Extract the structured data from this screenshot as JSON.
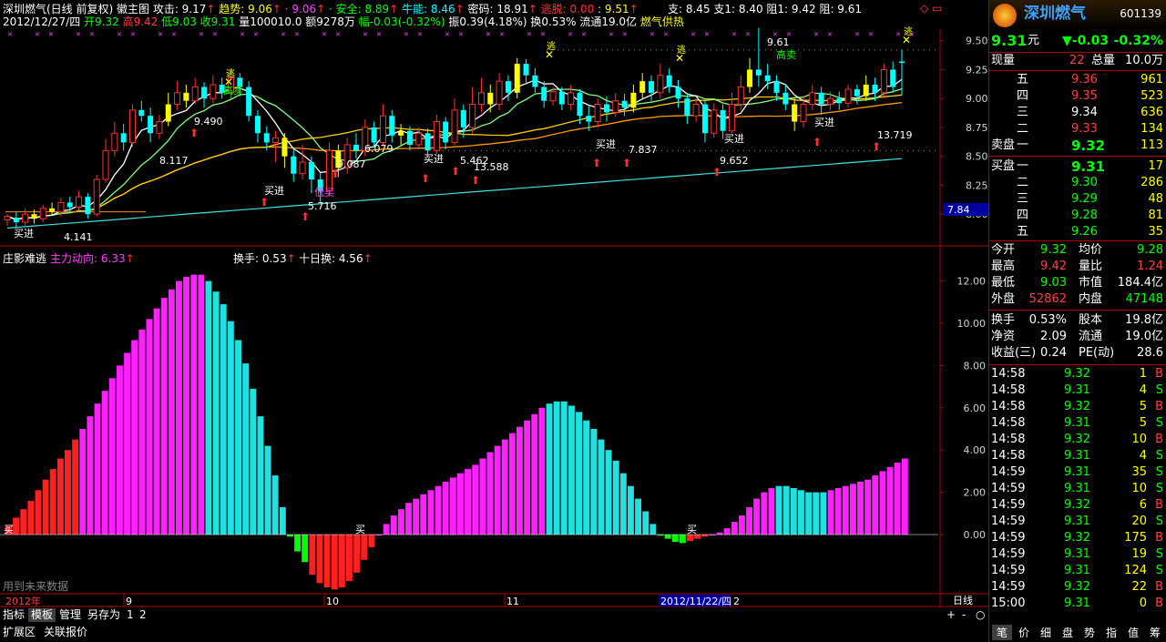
{
  "header": {
    "line1": [
      {
        "t": "深圳燃气(日线 前复权) 徽主图 ",
        "c": "#fff"
      },
      {
        "t": "攻击: 9.17",
        "c": "#fff"
      },
      {
        "t": "↑",
        "c": "#ff3030"
      },
      {
        "t": "  趋势: 9.06",
        "c": "#ffff00"
      },
      {
        "t": "↑",
        "c": "#ff3030"
      },
      {
        "t": "  ·  9.06",
        "c": "#ff40ff"
      },
      {
        "t": "↑",
        "c": "#ff3030"
      },
      {
        "t": "  · 安全: 8.89",
        "c": "#00ff00"
      },
      {
        "t": "↑",
        "c": "#ff3030"
      },
      {
        "t": "  牛能: 8.46",
        "c": "#00ffff"
      },
      {
        "t": "↑",
        "c": "#ff3030"
      },
      {
        "t": "  密码: 18.91",
        "c": "#fff"
      },
      {
        "t": "↑",
        "c": "#ff3030"
      },
      {
        "t": "  逃脱: 0.00",
        "c": "#ff3030"
      },
      {
        "t": "  : 9.51",
        "c": "#ffff00"
      },
      {
        "t": "↑",
        "c": "#ff3030"
      }
    ],
    "line2": [
      {
        "t": "2012/12/27/四 ",
        "c": "#fff"
      },
      {
        "t": "开9.32 ",
        "c": "#00ff00"
      },
      {
        "t": "高9.42 ",
        "c": "#ff4040"
      },
      {
        "t": "低9.03 ",
        "c": "#00ff00"
      },
      {
        "t": "收9.31 ",
        "c": "#00ff00"
      },
      {
        "t": "量100010.0 ",
        "c": "#fff"
      },
      {
        "t": "额9278万 ",
        "c": "#fff"
      },
      {
        "t": "幅-0.03(-0.32%) ",
        "c": "#00ff00"
      },
      {
        "t": "振0.39(4.18%) ",
        "c": "#fff"
      },
      {
        "t": "换0.53% ",
        "c": "#fff"
      },
      {
        "t": "流通19.0亿 ",
        "c": "#fff"
      },
      {
        "t": "燃气供热",
        "c": "#ffff00"
      }
    ],
    "support": "支: 8.45  支1: 8.40  阻1: 9.42  阻: 9.61"
  },
  "price_axis": [
    "9.50",
    "9.25",
    "9.00",
    "8.75",
    "8.50",
    "8.25",
    "8.00",
    "7.84"
  ],
  "indicator_axis": [
    "12.00",
    "10.00",
    "8.00",
    "6.00",
    "4.00",
    "2.00",
    "0.00"
  ],
  "indicator_header": {
    "name": "庄影难逃",
    "main_label": "主力动向: 6.33",
    "turnover": "换手: 0.53",
    "ten_day": "十日换: 4.56"
  },
  "annotations": {
    "p1": "8.117",
    "p2": "9.490",
    "p3": "5.716",
    "p4": "6.079",
    "p5": "9.087",
    "p6": "5.462",
    "p7": "13.588",
    "p8": "7.837",
    "p9": "9.652",
    "p10": "9.61",
    "p11": "13.719",
    "p12": "4.141",
    "buy": "买进",
    "sell_high": "高卖",
    "escape": "逃",
    "low_buy": "低买",
    "buy_short": "买"
  },
  "footer_note": "用到未来数据",
  "time_axis": {
    "start": "2012年",
    "m9": "9",
    "m10": "10",
    "m11": "11",
    "cursor": "2012/11/22/四",
    "m12": "2",
    "period": "日线"
  },
  "tabs": [
    "指标",
    "模板",
    "管理",
    "另存为",
    "1",
    "2"
  ],
  "bottom_tabs": [
    "扩展区",
    "关联报价"
  ],
  "zoom": [
    "+",
    "-",
    "○"
  ],
  "quote": {
    "name": "深圳燃气",
    "code": "601139",
    "price": "9.31",
    "unit": "元",
    "change": "▼-0.03",
    "pct": "-0.32%",
    "now_label": "现量",
    "now_val": "22",
    "total_label": "总量",
    "total_val": "10.0万",
    "asks": [
      {
        "l": "五",
        "p": "9.36",
        "v": "961"
      },
      {
        "l": "四",
        "p": "9.35",
        "v": "523"
      },
      {
        "l": "三",
        "p": "9.34",
        "v": "636"
      },
      {
        "l": "二",
        "p": "9.33",
        "v": "134"
      },
      {
        "l": "一",
        "p": "9.32",
        "v": "113"
      }
    ],
    "ask_label": "卖盘",
    "bid_label": "买盘",
    "bids": [
      {
        "l": "一",
        "p": "9.31",
        "v": "17"
      },
      {
        "l": "二",
        "p": "9.30",
        "v": "286"
      },
      {
        "l": "三",
        "p": "9.29",
        "v": "48"
      },
      {
        "l": "四",
        "p": "9.28",
        "v": "81"
      },
      {
        "l": "五",
        "p": "9.26",
        "v": "35"
      }
    ],
    "stats": [
      {
        "l1": "今开",
        "v1": "9.32",
        "c1": "green",
        "l2": "均价",
        "v2": "9.28",
        "c2": "green"
      },
      {
        "l1": "最高",
        "v1": "9.42",
        "c1": "red",
        "l2": "量比",
        "v2": "1.24",
        "c2": "red"
      },
      {
        "l1": "最低",
        "v1": "9.03",
        "c1": "green",
        "l2": "市值",
        "v2": "184.4亿",
        "c2": "white"
      },
      {
        "l1": "外盘",
        "v1": "52862",
        "c1": "red",
        "l2": "内盘",
        "v2": "47148",
        "c2": "green"
      }
    ],
    "stats2": [
      {
        "l1": "换手",
        "v1": "0.53%",
        "l2": "股本",
        "v2": "19.8亿"
      },
      {
        "l1": "净资",
        "v1": "2.09",
        "l2": "流通",
        "v2": "19.0亿"
      },
      {
        "l1": "收益(三)",
        "v1": "0.24",
        "l2": "PE(动)",
        "v2": "28.6"
      }
    ],
    "ticks": [
      {
        "t": "14:58",
        "p": "9.32",
        "v": "1",
        "s": "B"
      },
      {
        "t": "14:58",
        "p": "9.31",
        "v": "4",
        "s": "S"
      },
      {
        "t": "14:58",
        "p": "9.32",
        "v": "5",
        "s": "B"
      },
      {
        "t": "14:58",
        "p": "9.31",
        "v": "5",
        "s": "S"
      },
      {
        "t": "14:58",
        "p": "9.32",
        "v": "10",
        "s": "B"
      },
      {
        "t": "14:58",
        "p": "9.31",
        "v": "4",
        "s": "S"
      },
      {
        "t": "14:59",
        "p": "9.31",
        "v": "35",
        "s": "S"
      },
      {
        "t": "14:59",
        "p": "9.31",
        "v": "10",
        "s": "S"
      },
      {
        "t": "14:59",
        "p": "9.32",
        "v": "6",
        "s": "B"
      },
      {
        "t": "14:59",
        "p": "9.31",
        "v": "20",
        "s": "S"
      },
      {
        "t": "14:59",
        "p": "9.32",
        "v": "175",
        "s": "B"
      },
      {
        "t": "14:59",
        "p": "9.31",
        "v": "19",
        "s": "S"
      },
      {
        "t": "14:59",
        "p": "9.31",
        "v": "124",
        "s": "S"
      },
      {
        "t": "14:59",
        "p": "9.32",
        "v": "22",
        "s": "B"
      },
      {
        "t": "15:00",
        "p": "9.31",
        "v": "0",
        "s": "B"
      }
    ],
    "bottom_tabs": [
      "笔",
      "价",
      "细",
      "盘",
      "势",
      "指",
      "值",
      "筹"
    ]
  },
  "chart_data": {
    "type": "candlestick+bar",
    "candles": [
      [
        7.95,
        7.98,
        7.9,
        8.0
      ],
      [
        7.97,
        7.93,
        7.88,
        8.02
      ],
      [
        7.93,
        8.0,
        7.9,
        8.05
      ],
      [
        8.0,
        7.96,
        7.92,
        8.04
      ],
      [
        7.96,
        8.05,
        7.93,
        8.08
      ],
      [
        8.05,
        8.02,
        7.99,
        8.1
      ],
      [
        8.02,
        8.1,
        7.98,
        8.14
      ],
      [
        8.1,
        8.06,
        8.02,
        8.15
      ],
      [
        8.06,
        8.15,
        8.03,
        8.2
      ],
      [
        8.15,
        8.0,
        7.96,
        8.18
      ],
      [
        8.0,
        8.3,
        7.98,
        8.34
      ],
      [
        8.3,
        8.55,
        8.27,
        8.65
      ],
      [
        8.55,
        8.7,
        8.5,
        8.8
      ],
      [
        8.7,
        8.62,
        8.55,
        8.78
      ],
      [
        8.62,
        8.9,
        8.58,
        8.95
      ],
      [
        8.9,
        8.85,
        8.8,
        8.98
      ],
      [
        8.85,
        8.7,
        8.62,
        8.92
      ],
      [
        8.7,
        8.8,
        8.65,
        8.86
      ],
      [
        8.8,
        8.95,
        8.76,
        9.05
      ],
      [
        8.95,
        9.05,
        8.9,
        9.15
      ],
      [
        9.05,
        8.98,
        8.92,
        9.12
      ],
      [
        8.98,
        9.1,
        8.95,
        9.18
      ],
      [
        9.1,
        9.0,
        8.92,
        9.14
      ],
      [
        9.0,
        9.12,
        8.96,
        9.2
      ],
      [
        9.12,
        9.05,
        9.0,
        9.18
      ],
      [
        9.05,
        9.18,
        9.0,
        9.25
      ],
      [
        9.18,
        9.1,
        9.02,
        9.22
      ],
      [
        9.1,
        8.85,
        8.8,
        9.15
      ],
      [
        8.85,
        8.7,
        8.62,
        8.9
      ],
      [
        8.7,
        8.62,
        8.55,
        8.76
      ],
      [
        8.62,
        8.66,
        8.45,
        8.72
      ],
      [
        8.66,
        8.5,
        8.4,
        8.7
      ],
      [
        8.5,
        8.35,
        8.28,
        8.56
      ],
      [
        8.35,
        8.45,
        8.3,
        8.6
      ],
      [
        8.45,
        8.3,
        8.18,
        8.5
      ],
      [
        8.3,
        8.2,
        8.1,
        8.36
      ],
      [
        8.2,
        8.55,
        8.15,
        8.62
      ],
      [
        8.55,
        8.4,
        8.32,
        8.6
      ],
      [
        8.4,
        8.6,
        8.35,
        8.66
      ],
      [
        8.6,
        8.55,
        8.48,
        8.7
      ],
      [
        8.55,
        8.75,
        8.5,
        8.82
      ],
      [
        8.75,
        8.62,
        8.58,
        8.8
      ],
      [
        8.62,
        8.85,
        8.58,
        8.95
      ],
      [
        8.85,
        8.68,
        8.62,
        8.9
      ],
      [
        8.68,
        8.72,
        8.6,
        8.78
      ],
      [
        8.72,
        8.6,
        8.55,
        8.76
      ],
      [
        8.6,
        8.7,
        8.56,
        8.75
      ],
      [
        8.7,
        8.55,
        8.5,
        8.74
      ],
      [
        8.55,
        8.8,
        8.52,
        8.86
      ],
      [
        8.8,
        8.62,
        8.56,
        8.84
      ],
      [
        8.62,
        8.9,
        8.6,
        9.0
      ],
      [
        8.9,
        8.75,
        8.66,
        8.95
      ],
      [
        8.75,
        8.95,
        8.7,
        9.1
      ],
      [
        8.95,
        9.05,
        8.88,
        9.18
      ],
      [
        9.05,
        8.95,
        8.88,
        9.12
      ],
      [
        8.95,
        9.15,
        8.9,
        9.22
      ],
      [
        9.15,
        9.05,
        8.98,
        9.2
      ],
      [
        9.05,
        9.3,
        9.0,
        9.35
      ],
      [
        9.3,
        9.2,
        9.12,
        9.34
      ],
      [
        9.2,
        9.1,
        9.05,
        9.26
      ],
      [
        9.1,
        8.98,
        8.92,
        9.15
      ],
      [
        8.98,
        9.06,
        8.94,
        9.1
      ],
      [
        9.06,
        8.95,
        8.9,
        9.1
      ],
      [
        8.95,
        9.05,
        8.9,
        9.12
      ],
      [
        9.05,
        8.85,
        8.78,
        9.08
      ],
      [
        8.85,
        8.8,
        8.72,
        8.94
      ],
      [
        8.8,
        8.95,
        8.75,
        9.0
      ],
      [
        8.95,
        8.88,
        8.8,
        9.02
      ],
      [
        8.88,
        8.98,
        8.84,
        9.05
      ],
      [
        8.98,
        8.92,
        8.85,
        9.04
      ],
      [
        8.92,
        9.05,
        8.88,
        9.12
      ],
      [
        9.05,
        9.15,
        9.0,
        9.22
      ],
      [
        9.15,
        9.05,
        8.98,
        9.2
      ],
      [
        9.05,
        9.2,
        9.0,
        9.3
      ],
      [
        9.2,
        9.1,
        9.05,
        9.26
      ],
      [
        9.1,
        9.0,
        8.92,
        9.16
      ],
      [
        9.0,
        8.85,
        8.78,
        9.05
      ],
      [
        8.85,
        8.95,
        8.8,
        9.0
      ],
      [
        8.95,
        8.7,
        8.62,
        8.98
      ],
      [
        8.7,
        8.9,
        8.66,
        8.96
      ],
      [
        8.9,
        8.72,
        8.65,
        8.95
      ],
      [
        8.72,
        8.95,
        8.7,
        9.05
      ],
      [
        8.95,
        9.1,
        8.9,
        9.2
      ],
      [
        9.1,
        9.25,
        9.05,
        9.35
      ],
      [
        9.25,
        9.2,
        9.1,
        9.61
      ],
      [
        9.2,
        9.15,
        9.08,
        9.3
      ],
      [
        9.15,
        9.05,
        8.98,
        9.2
      ],
      [
        9.05,
        8.95,
        8.9,
        9.12
      ],
      [
        8.95,
        8.8,
        8.72,
        9.0
      ],
      [
        8.8,
        8.95,
        8.75,
        9.02
      ],
      [
        8.95,
        9.05,
        8.9,
        9.12
      ],
      [
        9.05,
        8.95,
        8.86,
        9.1
      ],
      [
        8.95,
        9.0,
        8.9,
        9.06
      ],
      [
        9.0,
        8.96,
        8.9,
        9.06
      ],
      [
        8.96,
        9.08,
        8.92,
        9.12
      ],
      [
        9.08,
        9.02,
        8.95,
        9.12
      ],
      [
        9.02,
        9.12,
        8.98,
        9.2
      ],
      [
        9.12,
        9.05,
        8.98,
        9.18
      ],
      [
        9.05,
        9.25,
        9.0,
        9.3
      ],
      [
        9.25,
        9.1,
        9.05,
        9.32
      ],
      [
        9.32,
        9.31,
        9.03,
        9.42
      ]
    ],
    "bars": [
      0.4,
      0.8,
      1.2,
      1.6,
      2.1,
      2.6,
      3.1,
      3.6,
      4.0,
      4.5,
      5.0,
      5.6,
      6.2,
      6.8,
      7.4,
      8.0,
      8.6,
      9.2,
      9.7,
      10.2,
      10.7,
      11.2,
      11.6,
      12.0,
      12.2,
      12.3,
      12.3,
      12.0,
      11.5,
      10.9,
      10.1,
      9.2,
      8.1,
      6.9,
      5.6,
      4.2,
      2.8,
      1.3,
      -0.1,
      -0.8,
      -1.3,
      -1.9,
      -2.3,
      -2.5,
      -2.6,
      -2.5,
      -2.2,
      -1.8,
      -1.2,
      -0.6,
      0.0,
      0.5,
      0.9,
      1.2,
      1.5,
      1.7,
      1.9,
      2.1,
      2.3,
      2.5,
      2.7,
      2.9,
      3.1,
      3.3,
      3.6,
      3.9,
      4.2,
      4.5,
      4.8,
      5.1,
      5.4,
      5.7,
      6.0,
      6.2,
      6.3,
      6.3,
      6.1,
      5.8,
      5.4,
      5.0,
      4.5,
      4.0,
      3.5,
      2.9,
      2.3,
      1.7,
      1.1,
      0.5,
      -0.05,
      -0.2,
      -0.35,
      -0.4,
      -0.3,
      -0.2,
      -0.1,
      0.0,
      0.1,
      0.3,
      0.6,
      0.9,
      1.3,
      1.7,
      2.0,
      2.2,
      2.3,
      2.3,
      2.2,
      2.1,
      2.0,
      2.0,
      2.0,
      2.1,
      2.2,
      2.3,
      2.4,
      2.5,
      2.6,
      2.8,
      3.0,
      3.2,
      3.4,
      3.6
    ],
    "price_range": [
      7.82,
      9.6
    ],
    "indicator_range": [
      -2.8,
      12.8
    ],
    "xlabels": [
      "2012年",
      "9",
      "10",
      "11",
      "2012/11/22/四",
      "2"
    ]
  }
}
